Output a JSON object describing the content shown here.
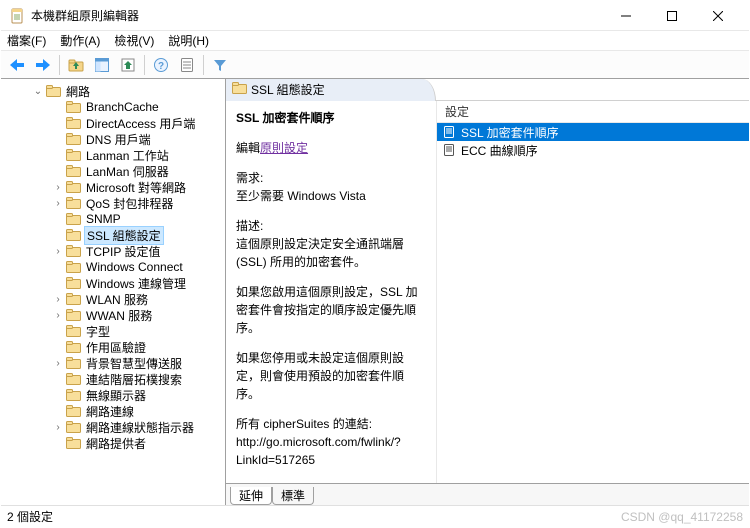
{
  "window": {
    "title": "本機群組原則編輯器"
  },
  "menu": {
    "file": "檔案(F)",
    "action": "動作(A)",
    "view": "檢視(V)",
    "help": "說明(H)"
  },
  "tree": {
    "root": "網路",
    "items": [
      {
        "label": "BranchCache"
      },
      {
        "label": "DirectAccess 用戶端"
      },
      {
        "label": "DNS 用戶端"
      },
      {
        "label": "Lanman 工作站"
      },
      {
        "label": "LanMan 伺服器"
      },
      {
        "label": "Microsoft 對等網路",
        "expandable": true
      },
      {
        "label": "QoS 封包排程器",
        "expandable": true
      },
      {
        "label": "SNMP"
      },
      {
        "label": "SSL 組態設定",
        "selected": true
      },
      {
        "label": "TCPIP 設定值",
        "expandable": true
      },
      {
        "label": "Windows Connect"
      },
      {
        "label": "Windows 連線管理"
      },
      {
        "label": "WLAN 服務",
        "expandable": true
      },
      {
        "label": "WWAN 服務",
        "expandable": true
      },
      {
        "label": "字型"
      },
      {
        "label": "作用區驗證"
      },
      {
        "label": "背景智慧型傳送服",
        "expandable": true
      },
      {
        "label": "連結階層拓樸搜索"
      },
      {
        "label": "無線顯示器"
      },
      {
        "label": "網路連線"
      },
      {
        "label": "網路連線狀態指示器",
        "expandable": true
      },
      {
        "label": "網路提供者"
      }
    ]
  },
  "header": {
    "title": "SSL 組態設定"
  },
  "desc": {
    "heading": "SSL 加密套件順序",
    "edit_label": "編輯",
    "edit_link": "原則設定",
    "req_label": "需求:",
    "req_value": "至少需要 Windows Vista",
    "about_label": "描述:",
    "about_text": "這個原則設定決定安全通訊端層 (SSL) 所用的加密套件。",
    "p1": "如果您啟用這個原則設定，SSL 加密套件會按指定的順序設定優先順序。",
    "p2": "如果您停用或未設定這個原則設定，則會使用預設的加密套件順序。",
    "link_label": "所有 cipherSuites 的連結:",
    "link_url": "http://go.microsoft.com/fwlink/?LinkId=517265"
  },
  "list": {
    "header": "設定",
    "rows": [
      {
        "label": "SSL 加密套件順序",
        "selected": true
      },
      {
        "label": "ECC 曲線順序"
      }
    ]
  },
  "tabs": {
    "extended": "延伸",
    "standard": "標準"
  },
  "status": {
    "count": "2 個設定"
  },
  "watermark": "CSDN @qq_41172258"
}
